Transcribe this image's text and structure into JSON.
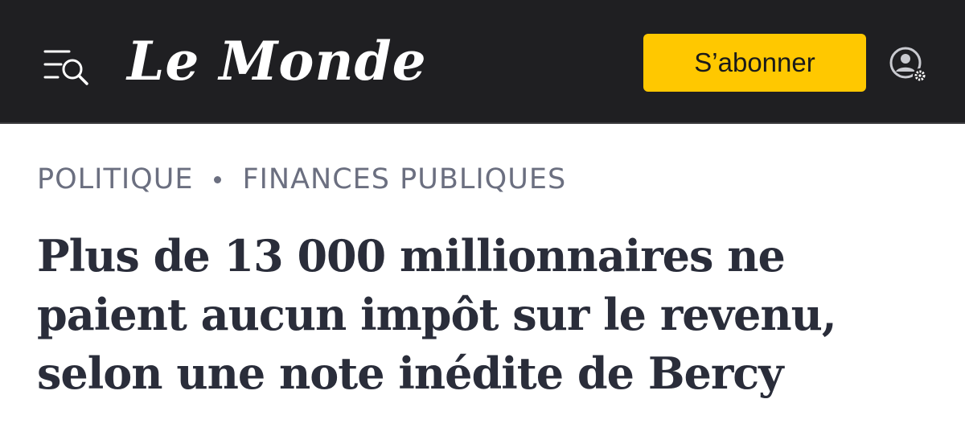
{
  "header": {
    "logo_text": "Le Monde",
    "menu_icon": "menu-search-icon",
    "subscribe_label": "S’abonner",
    "account_icon": "account-settings-icon",
    "background_color": "#1f1f22",
    "subscribe_color": "#ffc800"
  },
  "breadcrumb": {
    "section": "POLITIQUE",
    "subsection": "FINANCES PUBLIQUES"
  },
  "article": {
    "title": "Plus de 13 000 millionnaires ne paient aucun impôt sur le revenu, selon une note inédite de Bercy"
  }
}
